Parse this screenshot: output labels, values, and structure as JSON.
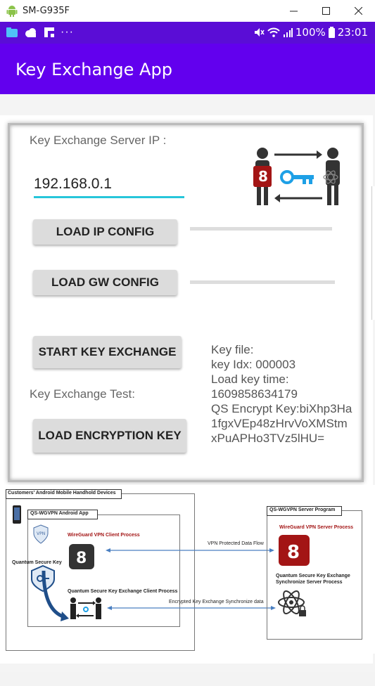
{
  "window": {
    "title": "SM-G935F",
    "minimize_icon": "minimize-icon",
    "maximize_icon": "maximize-icon",
    "close_icon": "close-icon"
  },
  "status_bar": {
    "battery": "100%",
    "time": "23:01",
    "left_icons": [
      "folder-icon",
      "cloud-icon",
      "flipboard-icon",
      "more-dots-icon"
    ],
    "right_icons": [
      "mute-icon",
      "wifi-icon",
      "signal-icon"
    ]
  },
  "app": {
    "title": "Key Exchange App",
    "accent": "#6200ee"
  },
  "form": {
    "server_ip_label": "Key Exchange Server IP :",
    "server_ip_value": "192.168.0.1",
    "load_ip_button": "LOAD IP CONFIG",
    "load_gw_button": "LOAD GW CONFIG",
    "start_key_exchange_button": "START KEY EXCHANGE",
    "key_exchange_test_label": "Key Exchange Test:",
    "load_encryption_key_button": "LOAD ENCRYPTION KEY"
  },
  "key_info": {
    "lines": [
      "Key file:",
      "key Idx: 000003",
      "Load key time:",
      "1609858634179",
      "QS Encrypt Key:biXhp3Ha",
      "1fgxVEp48zHrvVoXMStm",
      "xPuAPHo3TVz5lHU="
    ]
  },
  "diagram": {
    "customers_label": "Customers' Android Mobile Handhold Devices",
    "app_label": "QS-WGVPN Android App",
    "wireguard_client": "WireGuard VPN Client Process",
    "quantum_secure_key": "Quantum Secure Key",
    "qs_client": "Quantum Secure Key Exchange Client Process",
    "vpn_flow": "VPN Protected Data Flow",
    "encrypted_flow": "Encrypted Key Exchange Synchronize data",
    "server_label": "QS-WGVPN Server Program",
    "wireguard_server": "WireGuard VPN Server Process",
    "qs_server_1": "Quantum Secure Key Exchange",
    "qs_server_2": "Synchronize Server  Process",
    "icons": [
      "phone-icon",
      "vpn-icon",
      "wireguard-icon",
      "shield-key-icon",
      "atom-lock-icon",
      "exchange-icon"
    ]
  }
}
